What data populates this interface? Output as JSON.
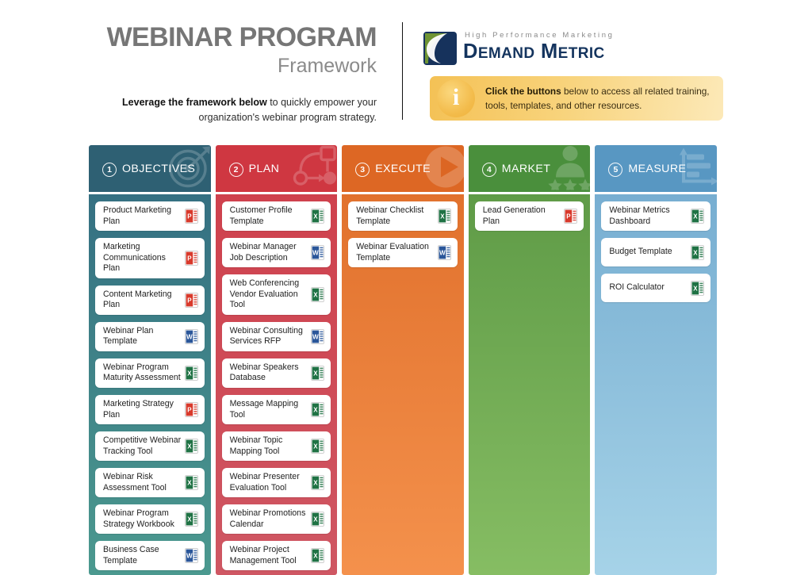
{
  "header": {
    "title_line1": "WEBINAR PROGRAM",
    "title_line2": "Framework",
    "lede_bold": "Leverage the framework below",
    "lede_rest": " to quickly empower your organization's webinar program strategy."
  },
  "logo": {
    "tagline": "High Performance Marketing",
    "name_demand": "DEMAND",
    "name_metric": "METRIC",
    "mark_green": "#6f9434",
    "mark_navy": "#16325c"
  },
  "info_banner": {
    "icon": "info-icon",
    "bold_text": "Click the buttons",
    "rest_text": " below to access all related training, tools, templates, and other resources.",
    "accent": "#f4c155"
  },
  "board": {
    "columns": [
      {
        "number": "1",
        "label": "OBJECTIVES",
        "icon": "target-icon",
        "head_color": "#2e6073",
        "body_top": "#357082",
        "body_bottom": "#4b998f",
        "items": [
          {
            "label": "Product Marketing Plan",
            "file": "pdf"
          },
          {
            "label": "Marketing Communications Plan",
            "file": "pdf"
          },
          {
            "label": "Content Marketing Plan",
            "file": "pdf"
          },
          {
            "label": "Webinar Plan Template",
            "file": "word"
          },
          {
            "label": "Webinar Program Maturity Assessment",
            "file": "excel"
          },
          {
            "label": "Marketing Strategy Plan",
            "file": "pdf"
          },
          {
            "label": "Competitive Webinar Tracking Tool",
            "file": "excel"
          },
          {
            "label": "Webinar Risk Assessment Tool",
            "file": "excel"
          },
          {
            "label": "Webinar Program Strategy Workbook",
            "file": "excel"
          },
          {
            "label": "Business Case Template",
            "file": "word"
          }
        ]
      },
      {
        "number": "2",
        "label": "PLAN",
        "icon": "flowchart-icon",
        "head_color": "#cf3741",
        "body_top": "#cf414d",
        "body_bottom": "#cf5763",
        "items": [
          {
            "label": "Customer Profile Template",
            "file": "excel"
          },
          {
            "label": "Webinar Manager Job Description",
            "file": "word"
          },
          {
            "label": "Web Conferencing Vendor Evaluation Tool",
            "file": "excel"
          },
          {
            "label": "Webinar Consulting Services RFP",
            "file": "word"
          },
          {
            "label": "Webinar Speakers Database",
            "file": "excel"
          },
          {
            "label": "Message Mapping Tool",
            "file": "excel"
          },
          {
            "label": "Webinar Topic Mapping Tool",
            "file": "excel"
          },
          {
            "label": "Webinar Presenter Evaluation Tool",
            "file": "excel"
          },
          {
            "label": "Webinar Promotions Calendar",
            "file": "excel"
          },
          {
            "label": "Webinar Project Management Tool",
            "file": "excel"
          }
        ]
      },
      {
        "number": "3",
        "label": "EXECUTE",
        "icon": "play-icon",
        "head_color": "#dd6724",
        "body_top": "#e1712d",
        "body_bottom": "#f4914c",
        "items": [
          {
            "label": "Webinar Checklist Template",
            "file": "excel"
          },
          {
            "label": "Webinar Evaluation Template",
            "file": "word"
          }
        ]
      },
      {
        "number": "4",
        "label": "MARKET",
        "icon": "audience-icon",
        "head_color": "#4a8f3c",
        "body_top": "#5f9b47",
        "body_bottom": "#86bd63",
        "items": [
          {
            "label": "Lead Generation Plan",
            "file": "pdf"
          }
        ]
      },
      {
        "number": "5",
        "label": "MEASURE",
        "icon": "bar-chart-icon",
        "head_color": "#5897c2",
        "body_top": "#77aed1",
        "body_bottom": "#a6d3e8",
        "items": [
          {
            "label": "Webinar Metrics Dashboard",
            "file": "excel"
          },
          {
            "label": "Budget Template",
            "file": "excel"
          },
          {
            "label": "ROI Calculator",
            "file": "excel"
          }
        ]
      }
    ]
  },
  "file_colors": {
    "pdf": "#d8392b",
    "word": "#2a5699",
    "excel": "#1f7244"
  }
}
